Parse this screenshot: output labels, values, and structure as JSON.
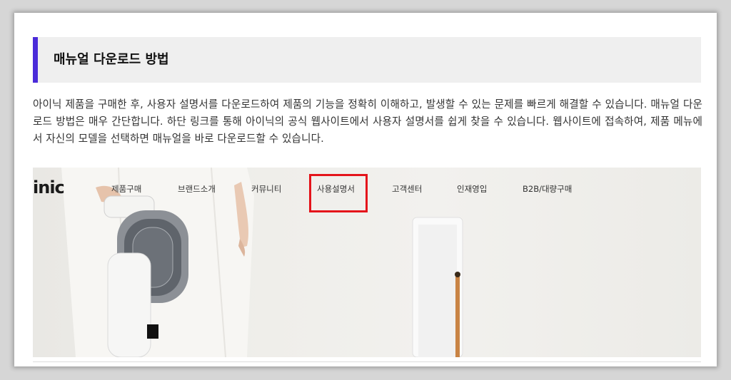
{
  "heading": "매뉴얼 다운로드 방법",
  "paragraph": "아이닉 제품을 구매한 후, 사용자 설명서를 다운로드하여 제품의 기능을 정확히 이해하고, 발생할 수 있는 문제를 빠르게 해결할 수 있습니다. 매뉴얼 다운로드 방법은 매우 간단합니다. 하단 링크를 통해 아이닉의 공식 웹사이트에서 사용자 설명서를 쉽게 찾을 수 있습니다. 웹사이트에 접속하여, 제품 메뉴에서 자신의 모델을 선택하면 매뉴얼을 바로 다운로드할 수 있습니다.",
  "site": {
    "logo": "inic",
    "nav": [
      "제품구매",
      "브랜드소개",
      "커뮤니티",
      "사용설명서",
      "고객센터",
      "인재영입",
      "B2B/대량구매"
    ],
    "highlighted": "사용설명서"
  },
  "colors": {
    "accent_bar": "#4a2bd9",
    "highlight_border": "#e4141b"
  }
}
